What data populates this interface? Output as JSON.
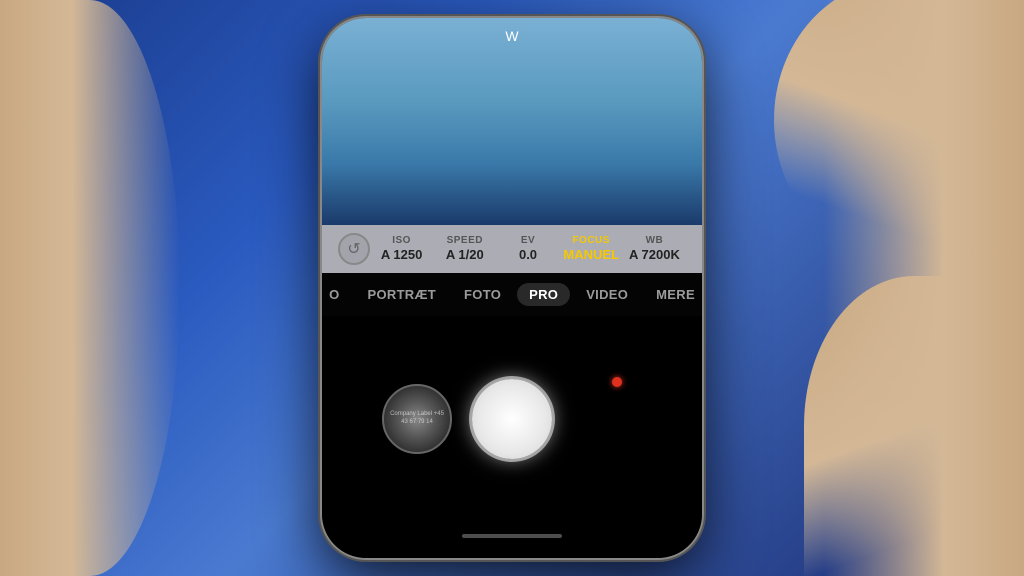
{
  "background": {
    "color": "#1a2a5e"
  },
  "phone": {
    "compass": {
      "label": "W"
    },
    "controls": {
      "reset_icon": "↺",
      "items": [
        {
          "label": "ISO",
          "value": "A 1250",
          "active": false
        },
        {
          "label": "SPEED",
          "value": "A 1/20",
          "active": false
        },
        {
          "label": "EV",
          "value": "0.0",
          "active": false
        },
        {
          "label": "FOCUS",
          "value": "MANUEL",
          "active": true
        },
        {
          "label": "WB",
          "value": "A 7200K",
          "active": false
        }
      ]
    },
    "modes": [
      {
        "label": "O",
        "active": false
      },
      {
        "label": "PORTRÆT",
        "active": false
      },
      {
        "label": "FOTO",
        "active": false
      },
      {
        "label": "PRO",
        "active": true
      },
      {
        "label": "VIDEO",
        "active": false
      },
      {
        "label": "MERE",
        "active": false
      }
    ],
    "thumbnail_text": "Company\nLabel\n+45 43 67 79 14",
    "bottom_swipe_label": ""
  }
}
